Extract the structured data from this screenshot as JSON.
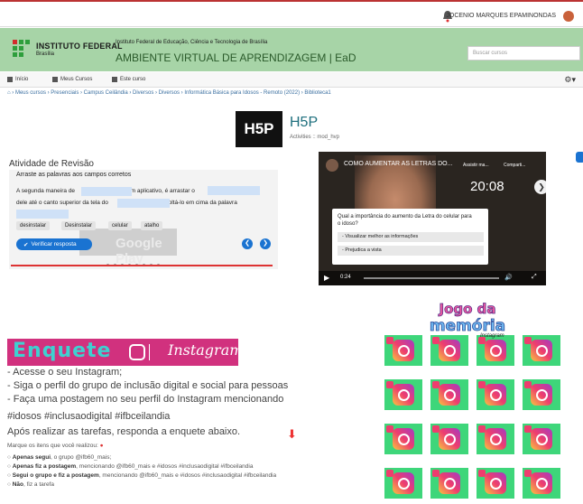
{
  "topbar": {
    "user_name": "JOCENIO MARQUES EPAMINONDAS"
  },
  "header": {
    "institution_name": "INSTITUTO FEDERAL",
    "institution_city": "Brasília",
    "institution_full": "Instituto Federal de Educação, Ciência e Tecnologia de Brasília",
    "ava_title": "AMBIENTE VIRTUAL DE APRENDIZAGEM | EaD",
    "search_placeholder": "Buscar cursos"
  },
  "nav": {
    "items": [
      {
        "label": "Início",
        "icon": "home-icon"
      },
      {
        "label": "Meus Cursos",
        "icon": "courses-icon"
      },
      {
        "label": "Este curso",
        "icon": "sitemap-icon"
      }
    ]
  },
  "breadcrumb": "› Meus cursos › Presenciais › Campus Ceilândia › Diversos › Diversos › Informática Básica para Idosos - Remoto (2022) › Biblioteca1",
  "h5p": {
    "logo": "H5P",
    "title": "H5P",
    "subtitle": "Activities :: mod_hvp"
  },
  "activity": {
    "title": "Atividade de Revisão",
    "instruction": "Arraste as palavras aos campos corretos",
    "line1_a": "A segunda maneira de",
    "line1_b": "um aplicativo, é arrastar o",
    "line2_a": "dele até o canto superior da tela do",
    "line2_b": "e soltá-lo em cima da palavra",
    "words": [
      "desinstalar",
      "Desinstalar",
      "celular",
      "atalho"
    ],
    "verify_label": "Verificar resposta",
    "bg_text": "Google Play"
  },
  "video": {
    "title": "COMO AUMENTAR AS LETRAS DO...",
    "overlay_time": "20:08",
    "current_time": "0:24",
    "watch_later": "Assistir ma...",
    "share": "Comparti...",
    "question": "Qual a importância do aumento da Letra do celular para o idoso?",
    "options": [
      "- Visualizar melhor as informações",
      "- Prejudica a vista"
    ]
  },
  "enquete": {
    "word": "Enquete",
    "insta_word": "Instagram",
    "lines": [
      "- Acesse o seu Instagram;",
      "- Siga o perfil do grupo de inclusão digital e social para pessoas",
      "- Faça uma postagem no seu perfil do Instagram mencionando",
      "#idosos #inclusaodigital #ifbceilandia",
      "Após realizar as tarefas, responda a enquete abaixo."
    ],
    "poll_question": "Marque os itens que você realizou:",
    "poll_options": [
      {
        "bold": "Apenas segui",
        "rest": ", o grupo @ifb60_mais;"
      },
      {
        "bold": "Apenas fiz a postagem",
        "rest": ", mencionando @ifb60_mais e #idosos #inclusaodigital #ifbceilandia"
      },
      {
        "bold": "Segui o grupo e fiz a postagem",
        "rest": ", mencionando @ifb60_mais e #idosos #inclusaodigital #ifbceilandia"
      },
      {
        "bold": "Não",
        "rest": ", fiz a tarefa"
      }
    ]
  },
  "memory_game": {
    "title_line1": "Jogo da",
    "title_line2": "memória",
    "card_label": "Instagram"
  },
  "colors": {
    "header_bg": "#a7d4a7",
    "accent_blue": "#1a73d1",
    "card_green": "#3ed67a",
    "banner_pink": "#d1317e"
  }
}
